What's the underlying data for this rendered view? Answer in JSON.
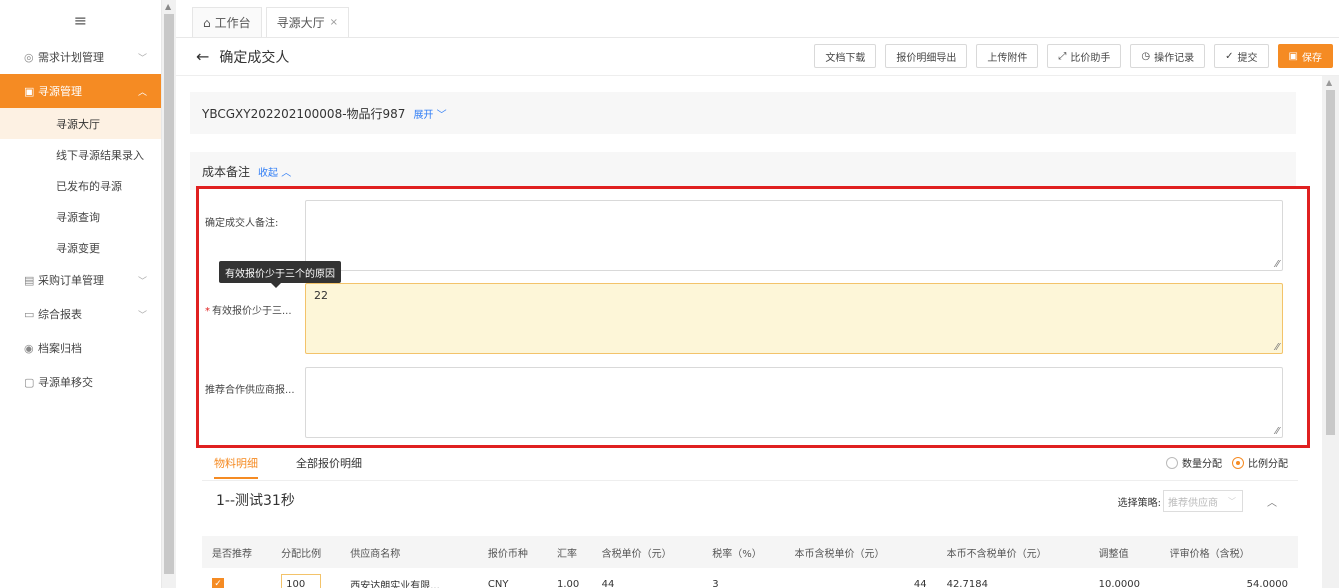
{
  "sidebar": {
    "menu_icon": "≡",
    "items": [
      {
        "label": "需求计划管理",
        "icon": "grid-icon"
      },
      {
        "label": "寻源管理",
        "icon": "source-icon"
      },
      {
        "label": "采购订单管理",
        "icon": "order-icon"
      },
      {
        "label": "综合报表",
        "icon": "report-icon"
      },
      {
        "label": "档案归档",
        "icon": "archive-icon"
      },
      {
        "label": "寻源单移交",
        "icon": "transfer-icon"
      }
    ],
    "subitems": [
      "寻源大厅",
      "线下寻源结果录入",
      "已发布的寻源",
      "寻源查询",
      "寻源变更"
    ]
  },
  "tabs": {
    "home": "工作台",
    "current": "寻源大厅"
  },
  "header": {
    "title": "确定成交人"
  },
  "toolbar": {
    "doc_download": "文档下载",
    "quote_export": "报价明细导出",
    "upload": "上传附件",
    "compare": "比价助手",
    "log": "操作记录",
    "submit": "提交",
    "save": "保存"
  },
  "order": {
    "code": "YBCGXY202202100008-物品行987",
    "expand": "展开"
  },
  "cost": {
    "title": "成本备注",
    "collapse": "收起"
  },
  "form": {
    "winner_note_label": "确定成交人备注:",
    "reason_label": "有效报价少于三...",
    "reason_tooltip": "有效报价少于三个的原因",
    "reason_value": "22",
    "recommend_label": "推荐合作供应商报..."
  },
  "subtabs": {
    "material": "物料明细",
    "all_quotes": "全部报价明细"
  },
  "alloc": {
    "qty": "数量分配",
    "ratio": "比例分配",
    "selected": "比例分配"
  },
  "section": {
    "title": "1--测试31秒",
    "strategy_label": "选择策略:",
    "strategy_placeholder": "推荐供应商"
  },
  "table": {
    "headers": [
      "是否推荐",
      "分配比例",
      "供应商名称",
      "报价币种",
      "汇率",
      "含税单价（元）",
      "税率（%）",
      "本币含税单价（元）",
      "本币不含税单价（元）",
      "调整值",
      "评审价格（含税）"
    ],
    "rows": [
      [
        "✓",
        "100",
        "西安达朗实业有限...",
        "CNY",
        "1.00",
        "44",
        "3",
        "44",
        "42.7184",
        "10.0000",
        "54.0000"
      ]
    ]
  },
  "colors": {
    "accent": "#f58b23",
    "alert_border": "#e02020",
    "link": "#2f7df6"
  }
}
